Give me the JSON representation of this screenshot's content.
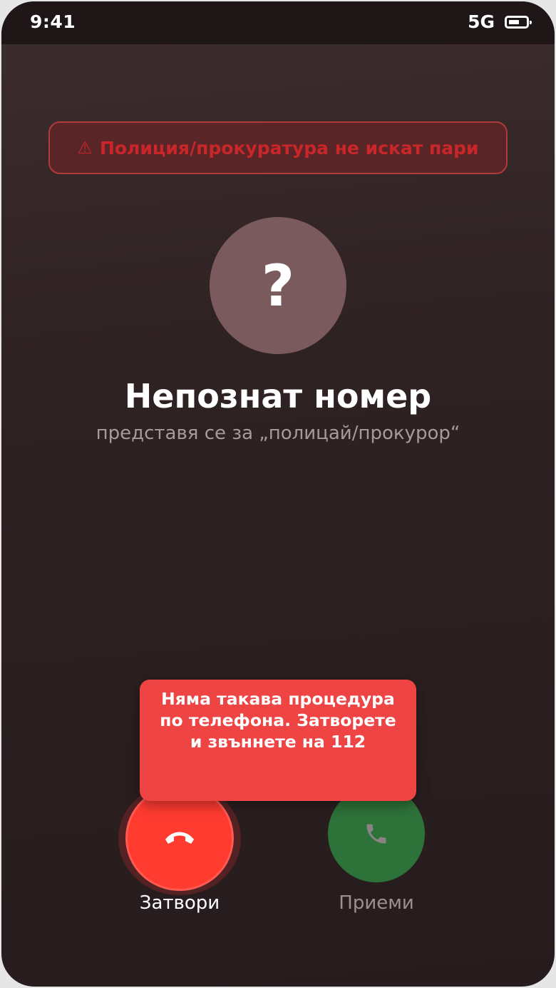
{
  "status_bar": {
    "time": "9:41",
    "network": "5G"
  },
  "warning": {
    "icon": "⚠",
    "text": "Полиция/прокуратура не искат пари"
  },
  "caller": {
    "avatar_symbol": "?",
    "name": "Непознат номер",
    "subtitle": "представя се за „полицай/прокурор“"
  },
  "tooltip": {
    "text": "Няма такава процедура по телефона. Затворете и звъннете на 112"
  },
  "actions": {
    "decline_label": "Затвори",
    "accept_label": "Приеми"
  },
  "colors": {
    "decline": "#ff3b30",
    "accept": "#2d7239",
    "tooltip": "#ef4444",
    "warning_text": "#c9262a"
  }
}
